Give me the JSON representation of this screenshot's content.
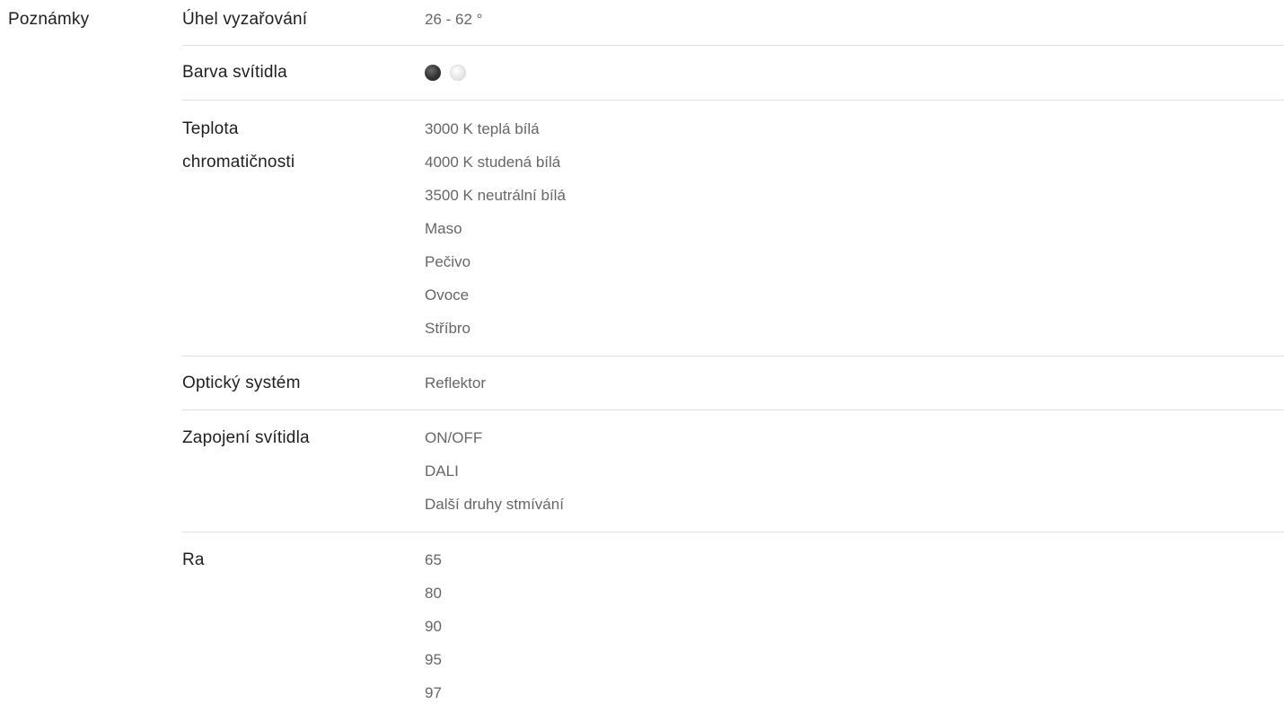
{
  "section": {
    "label": "Poznámky"
  },
  "rows": [
    {
      "label": "Úhel vyzařování",
      "values": [
        "26 - 62 °"
      ]
    },
    {
      "label": "Barva svítidla",
      "swatches": [
        {
          "name": "black-swatch",
          "color": "#333333"
        },
        {
          "name": "silver-swatch",
          "color": "#e6e6e6"
        }
      ]
    },
    {
      "label_lines": [
        "Teplota",
        "chromatičnosti"
      ],
      "values": [
        "3000 K teplá bílá",
        "4000 K studená bílá",
        "3500 K neutrální bílá",
        "Maso",
        "Pečivo",
        "Ovoce",
        "Stříbro"
      ]
    },
    {
      "label": "Optický systém",
      "values": [
        "Reflektor"
      ]
    },
    {
      "label": "Zapojení svítidla",
      "values": [
        "ON/OFF",
        "DALI",
        "Další druhy stmívání"
      ]
    },
    {
      "label": "Ra",
      "values": [
        "65",
        "80",
        "90",
        "95",
        "97"
      ]
    }
  ],
  "colors": {
    "label_text": "#1f1f1f",
    "value_text": "#666666",
    "divider": "#dedede"
  }
}
